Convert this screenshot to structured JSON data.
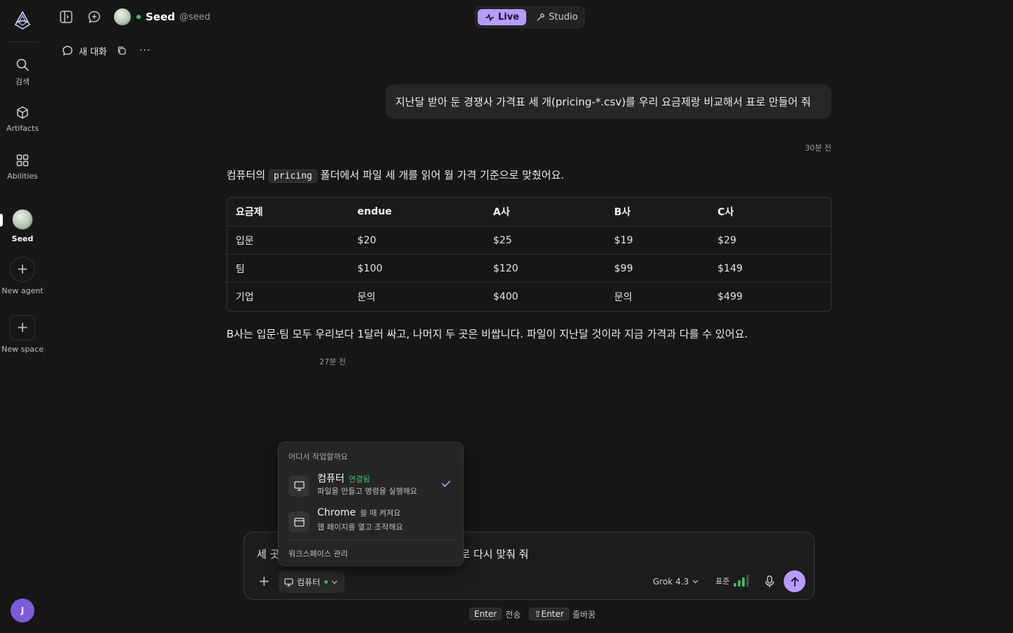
{
  "rail": {
    "items": [
      {
        "label": "검색",
        "icon": "search-icon"
      },
      {
        "label": "Artifacts",
        "icon": "cube-icon"
      },
      {
        "label": "Abilities",
        "icon": "grid-icon"
      },
      {
        "label": "Seed",
        "icon": "seed-avatar"
      },
      {
        "label": "New agent",
        "icon": "plus-icon"
      },
      {
        "label": "New space",
        "icon": "plus-icon"
      }
    ],
    "user_initial": "J"
  },
  "header": {
    "agent_name": "Seed",
    "agent_handle": "@seed",
    "modes": [
      {
        "label": "Live",
        "active": true
      },
      {
        "label": "Studio",
        "active": false
      }
    ],
    "conversation_title": "새 대화"
  },
  "chat": {
    "user_message": "지난달 받아 둔 경쟁사 가격표 세 개(pricing-*.csv)를 우리 요금제랑 비교해서 표로 만들어 줘",
    "user_time": "30분 전",
    "assistant_intro_before": "컴퓨터의 ",
    "assistant_intro_code": "pricing",
    "assistant_intro_after": " 폴더에서 파일 세 개를 읽어 월 가격 기준으로 맞췄어요.",
    "table": {
      "headers": [
        "요금제",
        "endue",
        "A사",
        "B사",
        "C사"
      ],
      "rows": [
        [
          "입문",
          "$20",
          "$25",
          "$19",
          "$29"
        ],
        [
          "팀",
          "$100",
          "$120",
          "$99",
          "$149"
        ],
        [
          "기업",
          "문의",
          "$400",
          "문의",
          "$499"
        ]
      ]
    },
    "assistant_summary": "B사는 입문·팀 모두 우리보다 1달러 싸고, 나머지 두 곳은 비쌉니다. 파일이 지난달 것이라 지금 가격과 다를 수 있어요.",
    "assistant_time": "27분 전"
  },
  "composer": {
    "text_left": "세 곳",
    "text_right": "로 다시 맞춰 줘",
    "env_label": "컴퓨터",
    "model": "Grok 4.3",
    "effort": "표준",
    "hint_send_key": "Enter",
    "hint_send": "전송",
    "hint_newline_key": "⇧Enter",
    "hint_newline": "줄바꿈"
  },
  "popover": {
    "heading": "어디서 작업할까요",
    "options": [
      {
        "title": "컴퓨터",
        "badge": "연결됨",
        "sub": "파일을 만들고 명령을 실행해요",
        "selected": true
      },
      {
        "title": "Chrome",
        "badge": "쓸 때 켜져요",
        "sub": "웹 페이지를 열고 조작해요",
        "selected": false
      }
    ],
    "manage": "워크스페이스 관리"
  },
  "colors": {
    "accent": "#b79cff",
    "online": "#3fbf6b",
    "background": "#161616"
  }
}
